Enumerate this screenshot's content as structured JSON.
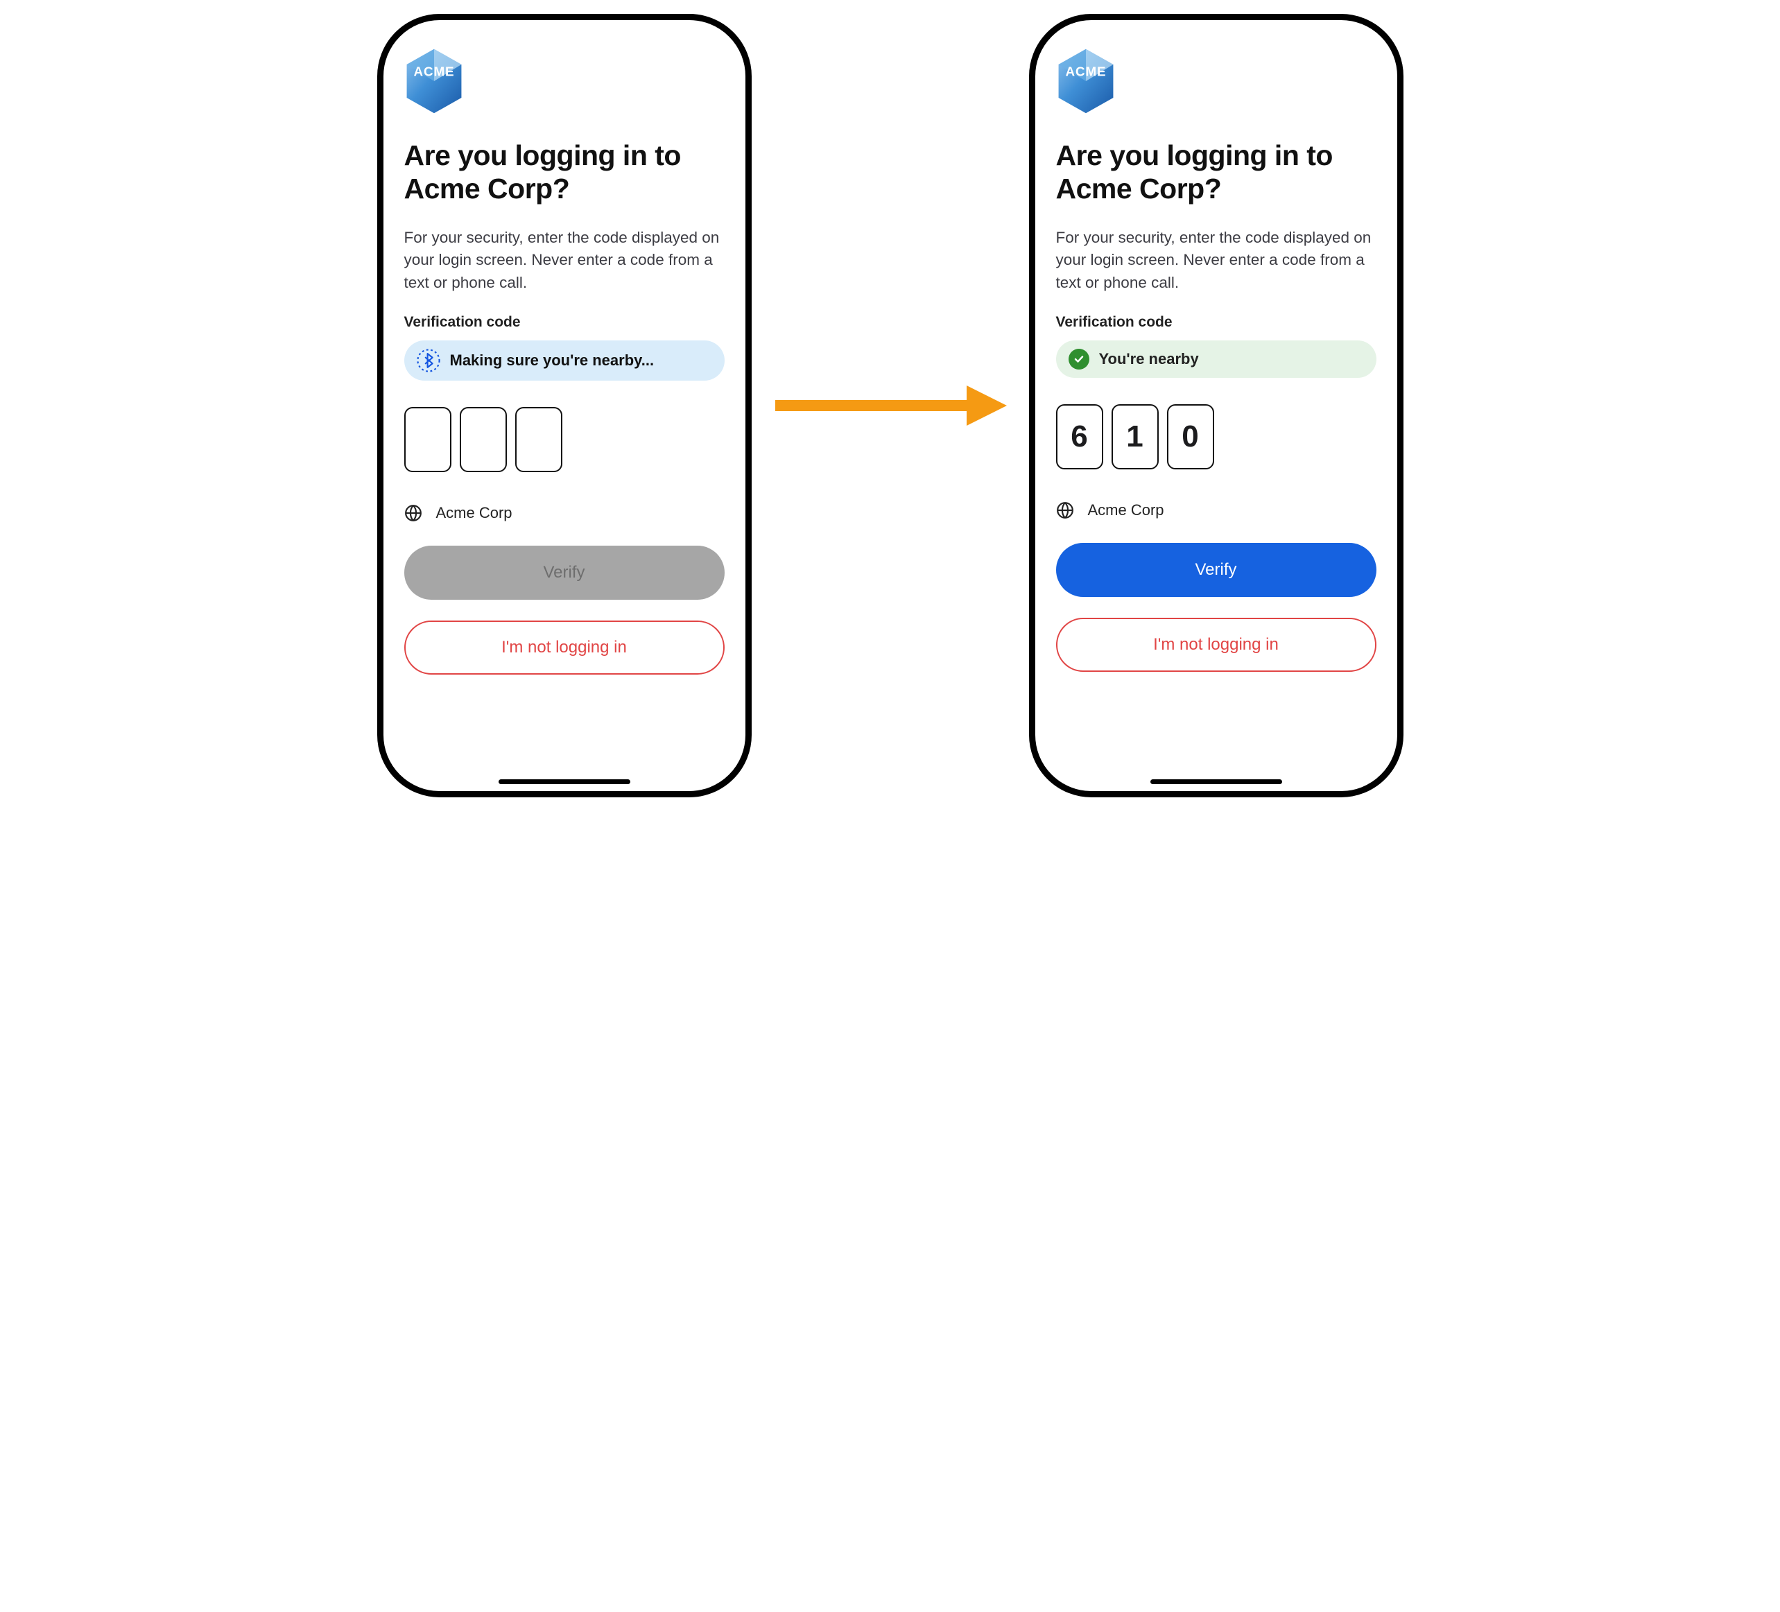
{
  "brand": {
    "name": "ACME"
  },
  "title": "Are you logging in to Acme Corp?",
  "subtitle": "For your security, enter the code displayed on your login screen. Never enter a code from a text or phone call.",
  "verification_label": "Verification code",
  "status": {
    "checking": "Making sure you're nearby...",
    "nearby": "You're nearby"
  },
  "code": {
    "d1": "6",
    "d2": "1",
    "d3": "0"
  },
  "org_name": "Acme Corp",
  "buttons": {
    "verify": "Verify",
    "deny": "I'm not logging in"
  }
}
